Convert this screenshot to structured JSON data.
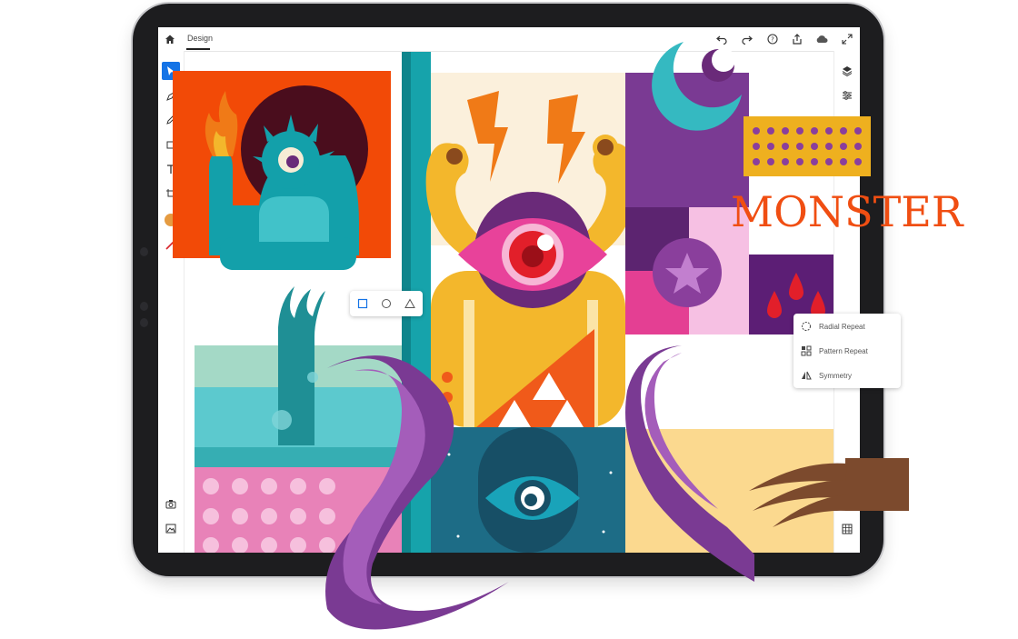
{
  "topbar": {
    "home_icon": "home-icon",
    "tab_label": "Design",
    "actions": [
      "undo-icon",
      "redo-icon",
      "help-icon",
      "share-icon",
      "cloud-icon",
      "fullscreen-icon"
    ]
  },
  "toolbar": {
    "tools": [
      "select-tool-icon",
      "pen-tool-icon",
      "pencil-tool-icon",
      "shape-tool-icon",
      "text-tool-icon",
      "crop-tool-icon",
      "fill-swatch",
      "stroke-swatch"
    ],
    "bottom": [
      "camera-icon",
      "image-import-icon"
    ],
    "fill_color": "#e59b41",
    "stroke_color": "#d8262b",
    "accent_color": "#1473e6"
  },
  "rightbar": {
    "items": [
      "layers-icon",
      "properties-icon",
      "repeat-grid-icon"
    ]
  },
  "shape_popover": {
    "options": [
      "rectangle-icon",
      "ellipse-icon",
      "triangle-icon"
    ]
  },
  "repeat_menu": {
    "items": [
      {
        "label": "Radial Repeat",
        "icon": "radial-repeat-icon"
      },
      {
        "label": "Pattern Repeat",
        "icon": "pattern-repeat-icon"
      },
      {
        "label": "Symmetry",
        "icon": "symmetry-icon"
      }
    ]
  },
  "artwork": {
    "title_text": "MONSTER",
    "colors": {
      "orange": "#f24a07",
      "teal": "#16a3ab",
      "purple": "#7a3a93",
      "yellow": "#f3b72c",
      "pink": "#e8429a",
      "brown": "#7c4a2d"
    }
  }
}
